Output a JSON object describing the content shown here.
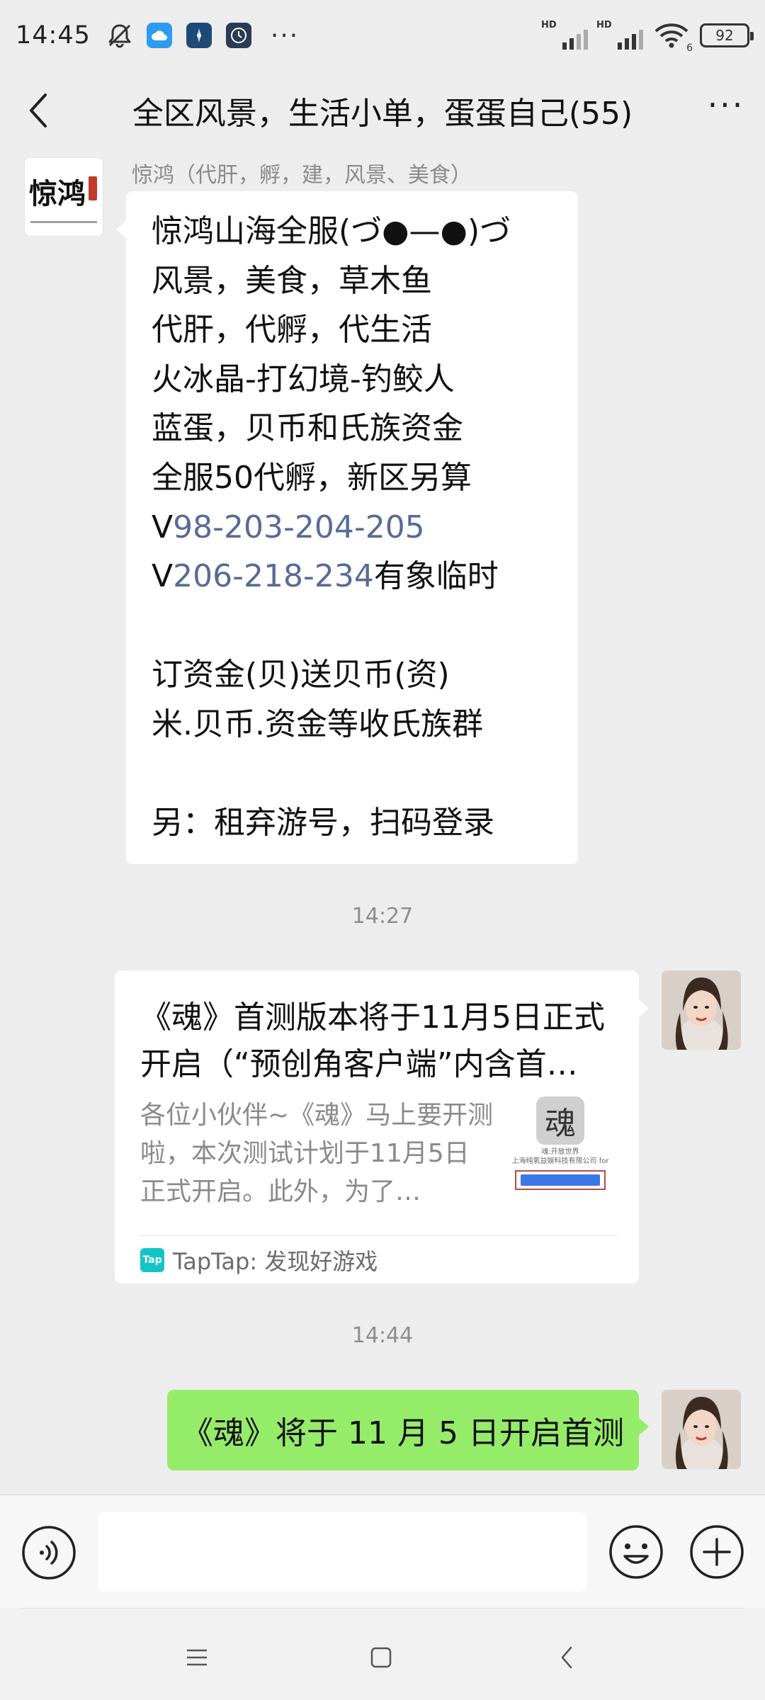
{
  "status_bar": {
    "time": "14:45",
    "network_label": "HD",
    "wifi_label": "6",
    "battery": "92",
    "more": "···"
  },
  "header": {
    "title": "全区风景，生活小单，蛋蛋自己(55)"
  },
  "messages": [
    {
      "type": "text",
      "side": "left",
      "sender": "惊鸿（代肝，孵，建，风景、美食）",
      "avatar_text": "惊鸿",
      "lines": [
        "惊鸿山海全服(づ●—●)づ",
        "风景，美食，草木鱼",
        "代肝，代孵，代生活",
        "火冰晶-打幻境-钓鲛人",
        "蓝蛋，贝币和氏族资金",
        "全服50代孵，新区另算",
        {
          "prefix": "V",
          "link": "98-203-204-205",
          "suffix": ""
        },
        {
          "prefix": "V",
          "link": "206-218-234",
          "suffix": "有象临时"
        },
        "",
        "订资金(贝)送贝币(资)",
        "米.贝币.资金等收氏族群",
        "",
        "另：租弃游号，扫码登录"
      ]
    },
    {
      "type": "time",
      "text": "14:27"
    },
    {
      "type": "card",
      "side": "right",
      "title": "《魂》首测版本将于11月5日正式开启（“预创角客户端”内含首…",
      "desc": "各位小伙伴~《魂》马上要开测啦，本次测试计划于11月5日正式开启。此外，为了…",
      "thumb_logo": "魂",
      "thumb_caption": "魂:开放世界\n上海纯氧益娱科技有限公司 for",
      "source": "TapTap: 发现好游戏",
      "source_icon": "Tap"
    },
    {
      "type": "time",
      "text": "14:44"
    },
    {
      "type": "text",
      "side": "right",
      "text": "《魂》将于 11 月 5 日开启首测"
    }
  ],
  "icons": {
    "status": [
      "mute-bell-icon",
      "cloud-app-icon",
      "compass-app-icon",
      "clock-app-icon"
    ],
    "header": [
      "back-arrow-icon",
      "more-icon"
    ],
    "input": [
      "voice-icon",
      "emoji-icon",
      "plus-icon"
    ],
    "nav": [
      "menu-icon",
      "home-icon",
      "back-icon"
    ]
  },
  "colors": {
    "background": "#ededed",
    "bubble_self": "#95ec69",
    "bubble_other": "#ffffff",
    "link": "#576b95",
    "taptap": "#14c4c4"
  }
}
